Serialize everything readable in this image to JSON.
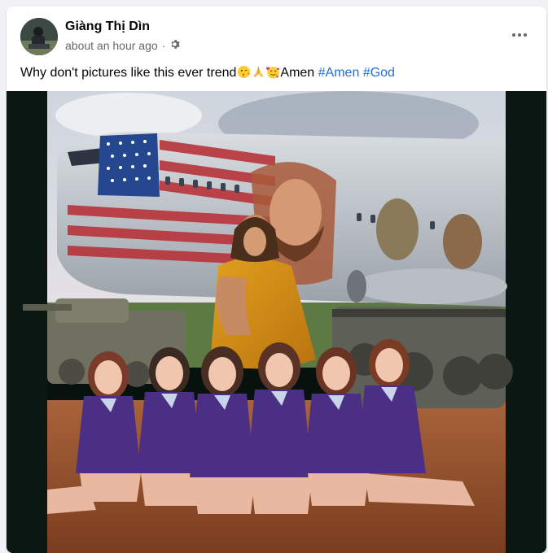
{
  "post": {
    "author": "Giàng Thị Dìn",
    "timestamp": "about an hour ago",
    "audience_icon": "gear-icon",
    "more_icon": "more-options-icon",
    "caption_text": "Why don't pictures like this ever trend",
    "caption_emojis": [
      "kissing-face-emoji",
      "praying-hands-emoji",
      "smiling-face-with-hearts-emoji"
    ],
    "caption_word": "Amen",
    "hashtags": [
      "#Amen",
      "#God"
    ]
  },
  "colors": {
    "link": "#216fdb",
    "secondary_text": "#65676b",
    "background": "#f0f2f5"
  }
}
